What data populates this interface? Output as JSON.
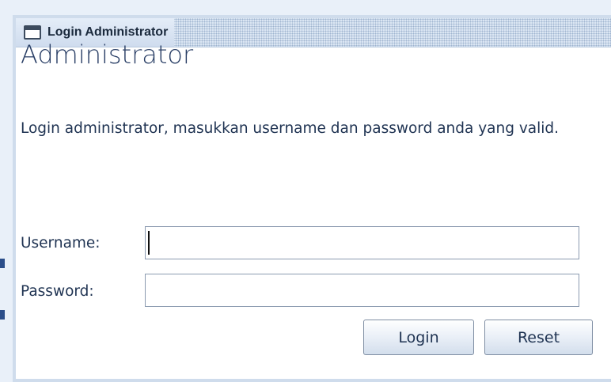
{
  "window": {
    "title": "Login Administrator"
  },
  "form": {
    "heading": "Administrator",
    "description": "Login administrator, masukkan username dan password anda yang valid.",
    "username_label": "Username:",
    "username_value": "",
    "password_label": "Password:",
    "password_value": "",
    "login_button": "Login",
    "reset_button": "Reset"
  },
  "colors": {
    "heading": "#2a3f66",
    "text": "#1f3352",
    "window_border": "#cfdcec",
    "titlebar": "#dbe6f3"
  },
  "icons": {
    "window": "window-icon"
  }
}
